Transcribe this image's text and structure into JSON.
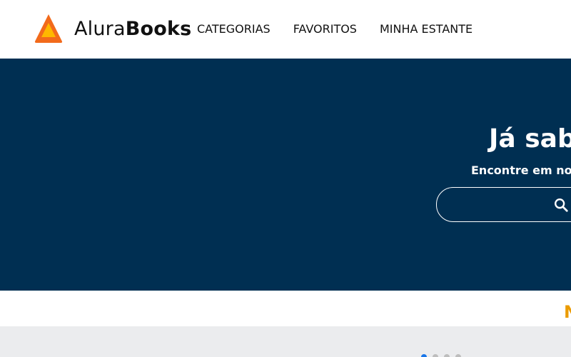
{
  "header": {
    "logo": {
      "name_part1": "Alura",
      "name_part2": "Books"
    },
    "nav": [
      {
        "label": "CATEGORIAS"
      },
      {
        "label": "FAVORITOS"
      },
      {
        "label": "MINHA ESTANTE"
      }
    ]
  },
  "hero": {
    "title": "Já sab",
    "subtitle": "Encontre em noss",
    "search": {
      "value": "",
      "icon": "search-icon"
    }
  },
  "releases": {
    "title": "N"
  },
  "carousel": {
    "dots": 4,
    "active_dot": 0
  },
  "colors": {
    "hero_bg": "#002f52",
    "logo_orange": "#f26a1b",
    "logo_yellow": "#ffb800",
    "accent_yellow": "#eb9b00",
    "active_dot": "#1875e8"
  }
}
